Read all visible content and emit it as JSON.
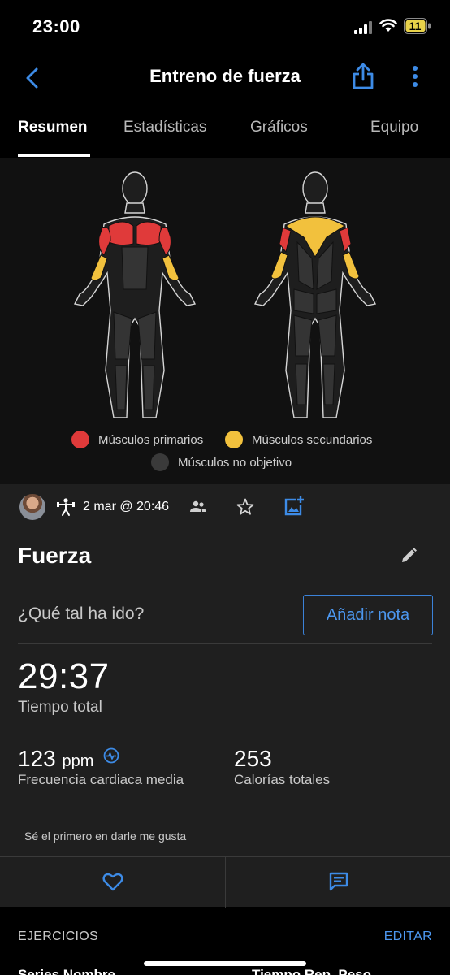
{
  "status_bar": {
    "time": "23:00",
    "battery": "11"
  },
  "header": {
    "title": "Entreno de fuerza"
  },
  "tabs": [
    {
      "label": "Resumen",
      "active": true
    },
    {
      "label": "Estadísticas",
      "active": false
    },
    {
      "label": "Gráficos",
      "active": false
    },
    {
      "label": "Equipo",
      "active": false
    }
  ],
  "legend": {
    "primary": {
      "label": "Músculos primarios",
      "color": "#e03a3a"
    },
    "secondary": {
      "label": "Músculos secundarios",
      "color": "#f2c13d"
    },
    "none": {
      "label": "Músculos no objetivo",
      "color": "#3a3a3a"
    }
  },
  "activity": {
    "date": "2 mar @ 20:46",
    "name": "Fuerza",
    "note_prompt": "¿Qué tal ha ido?",
    "add_note_label": "Añadir nota",
    "total_time": "29:37",
    "total_time_label": "Tiempo total",
    "heart_rate_value": "123",
    "heart_rate_unit": "ppm",
    "heart_rate_label": "Frecuencia cardiaca media",
    "calories_value": "253",
    "calories_label": "Calorías totales",
    "like_prompt": "Sé el primero en darle me gusta"
  },
  "exercises": {
    "header": "EJERCICIOS",
    "edit_label": "EDITAR",
    "columns_left": "Series  Nombre",
    "columns_right": "Tiempo  Rep.  Peso"
  },
  "colors": {
    "accent": "#4c97ef",
    "primary_muscle": "#e03a3a",
    "secondary_muscle": "#f2c13d"
  }
}
